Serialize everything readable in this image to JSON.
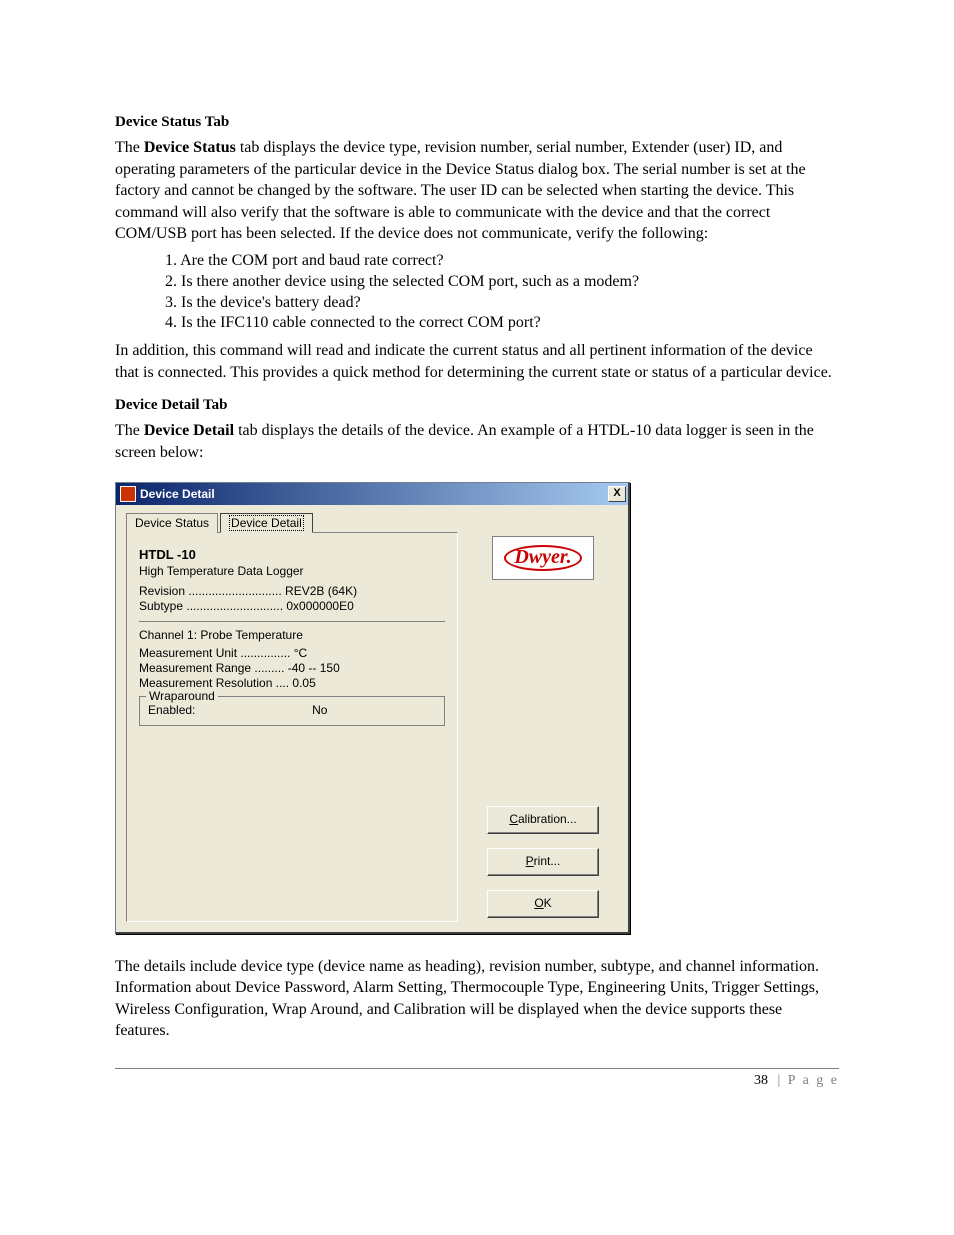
{
  "doc": {
    "sec1_heading": "Device Status Tab",
    "sec1_para_pre": "The ",
    "sec1_strong": "Device Status",
    "sec1_para_post": " tab displays the device type, revision number, serial number, Extender (user) ID, and operating parameters of the particular device in the Device Status dialog box. The serial number is set at the factory and cannot be changed by the software. The user ID can be selected when starting the device. This command will also verify that the software is able to communicate with the device and that the correct COM/USB port has been selected. If the device does not communicate, verify the following:",
    "list1": "1. Are the COM port and baud rate correct?",
    "list2": "2. Is there another device using the selected COM port, such as a modem?",
    "list3": "3. Is the device's battery dead?",
    "list4": "4. Is the IFC110 cable connected to the correct COM port?",
    "sec1_para2": "In addition, this command will read and indicate the current status and all pertinent information of the device that is connected. This provides a quick method for determining the current state or status of a particular device.",
    "sec2_heading": "Device Detail Tab",
    "sec2_para_pre": "The ",
    "sec2_strong": "Device Detail",
    "sec2_para_post": " tab displays the details of the device. An example of a HTDL-10 data logger is seen in the screen below:",
    "sec2_para2": "The details include device type (device name as heading), revision number, subtype, and channel information. Information about Device Password, Alarm Setting, Thermocouple Type, Engineering Units, Trigger Settings, Wireless Configuration, Wrap Around, and Calibration will be displayed when the device supports these features.",
    "page_number": "38",
    "page_label": " | P a g e"
  },
  "dialog": {
    "title": "Device Detail",
    "close": "X",
    "tab1": "Device Status",
    "tab2": "Device Detail",
    "device_name": "HTDL -10",
    "device_desc": "High Temperature Data Logger",
    "revision_line": "Revision  ............................  REV2B (64K)",
    "subtype_line": "Subtype  .............................  0x000000E0",
    "channel_heading": "Channel 1: Probe Temperature",
    "unit_line": "Measurement Unit  ...............  °C",
    "range_line": "Measurement Range  .........  -40 -- 150",
    "res_line": "Measurement Resolution  ....  0.05",
    "wrap_legend": "Wraparound",
    "wrap_label": "Enabled:",
    "wrap_value": "No",
    "logo": "Dwyer.",
    "btn_cal": "alibration...",
    "btn_cal_u": "C",
    "btn_print": "rint...",
    "btn_print_u": "P",
    "btn_ok": "K",
    "btn_ok_u": "O"
  }
}
